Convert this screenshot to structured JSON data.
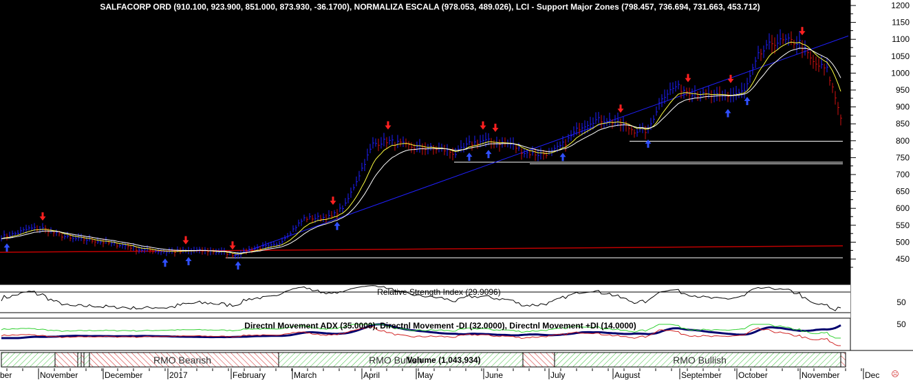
{
  "chart_data": {
    "type": "line",
    "title": "SALFACORP ORD (910.100, 923.900, 851.000, 873.930, -36.1700), NORMALIZA ESCALA (978.053, 489.026), LCI - Support Major Zones (798.457, 736.694, 731.663, 453.712)",
    "ylim": [
      400,
      1220
    ],
    "y_ticks": [
      1200,
      1150,
      1100,
      1050,
      1000,
      950,
      900,
      850,
      800,
      750,
      700,
      650,
      600,
      550,
      500,
      450
    ],
    "weekly_close": [
      515,
      525,
      540,
      540,
      525,
      510,
      508,
      503,
      495,
      490,
      478,
      475,
      472,
      472,
      475,
      474,
      470,
      462,
      478,
      485,
      490,
      530,
      570,
      572,
      575,
      610,
      700,
      790,
      800,
      790,
      780,
      778,
      775,
      762,
      790,
      800,
      795,
      790,
      765,
      760,
      765,
      795,
      840,
      860,
      862,
      850,
      830,
      830,
      930,
      960,
      945,
      935,
      930,
      935,
      945,
      1050,
      1090,
      1095,
      1090,
      1030,
      1010,
      873
    ],
    "support_zones": [
      798.457,
      736.694,
      731.663,
      453.712
    ],
    "normaliza_line": [
      470,
      489.026
    ],
    "sell_signals": [
      3,
      13.4,
      16.8,
      24.1,
      28.1,
      35,
      35.9,
      45,
      49.9,
      53,
      58.2
    ],
    "buy_signals": [
      0.4,
      11.9,
      13.6,
      17.2,
      24.4,
      34,
      35.4,
      40.8,
      47,
      52.8,
      54.2
    ],
    "x_labels": [
      "ber",
      "November",
      "December",
      "2017",
      "February",
      "March",
      "April",
      "May",
      "June",
      "July",
      "August",
      "September",
      "October",
      "November",
      "Dec"
    ],
    "rsi": {
      "label": "Relative Strength Index (29.9096)",
      "tick": "50"
    },
    "dmi": {
      "label": "Directnl Movement ADX (35.0000), Directnl Movement -DI (32.0000), Directnl Movement +DI (14.0000)",
      "tick": "50"
    },
    "rmo": {
      "bearish": "RMO Bearish",
      "bullish": "RMO Bullish",
      "volume": "Volume (1,043,934)"
    }
  },
  "colors": {
    "up": "#1e1eff",
    "down": "#d01010",
    "ma_fast": "#ffff40",
    "ma_slow": "#ffffff",
    "trend": "#2020ff",
    "norm": "#c00000"
  }
}
